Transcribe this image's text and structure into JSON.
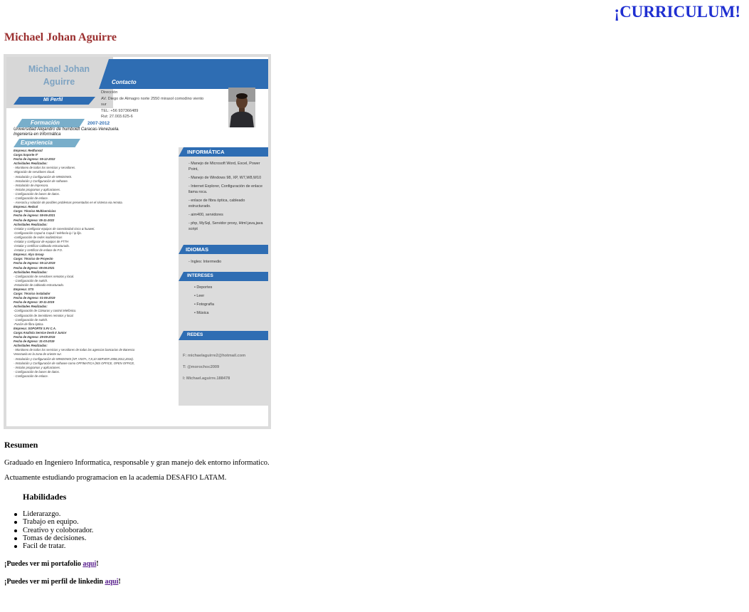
{
  "header": {
    "title": "¡CURRICULUM!"
  },
  "profile": {
    "name": "Michael Johan Aguirre"
  },
  "cv_image": {
    "name_line1": "Michael Johan",
    "name_line2": "Aguirre",
    "contact_label": "Contacto",
    "perfil_label": "Mi Perfil",
    "contact_lines": [
      "Dirección",
      "AV. Diego de Almagro norte 2550 mirasol comodino viento",
      "sur",
      "TEL: +56 937366489",
      "Rut: 27.003.625-6"
    ],
    "formacion_label": "Formación",
    "formacion_years": "2007-2012",
    "formacion_text": [
      "Universidad Alejandro de humboldt Caracas-Venezuela.",
      "Ingeniería en Informática"
    ],
    "experiencia_label": "Experiencia",
    "experiencia_lines": [
      "Empresa: Redfunsid",
      "Cargo:Soporte IT",
      "Fecha de ingreso: 05-12-2022",
      "Actividades Realizadas:",
      "- Monitoreo de todos los servicios y servidores.",
      "-Migración de servidores cloud.",
      "- Instalación y Configuración de WINDOWS.",
      "- Instalación y Configuración de software.",
      "- Instalación de impresora.",
      "- Instalar programas y aplicaciones.",
      "- Configuración de bases de datos.",
      "- Configuración de enlace.",
      "- Asesoría y solución de posibles problemas presentados en el sistema via remota.",
      "Empresa: Redsol",
      "Cargo: Técnico Multiservicios",
      "Fecha de ingreso: 08-06-2021",
      "Fecha de Egreso: 05-11-2022",
      "Actividades Realizadas:",
      "-instalar y configurar equipos de conectividad cisco & huawei.",
      "-Configuración Cayud & Cupuli / telefonía ip / ip fijo.",
      "-configuración de redes inalámbricas",
      "-instalar y configurar de equipos de FTTH",
      "-instalar y certificar cableado estructurado.",
      "-instalar y certificar de enlace de F.O.",
      "Empresa: Alyx Group",
      "Cargo: Técnico de Proyecto",
      "Fecha de Ingreso: 05-12-2019",
      "Fecha de Egreso: 05-06-2021",
      "Actividades Realizadas:",
      "- Configuración de servidores remotos y local.",
      "- Configuración de switch.",
      "-Instalación de cableado estructurado.",
      "Empresa: STS",
      "Cargo: Técnico instalador",
      "Fecha de Ingreso: 01-06-2019",
      "Fecha de Egreso: 30-11-2019",
      "Actividades Realizadas:",
      "-Configuración de Cámaras y control telefónico.",
      "-Configuración de Servidores remotos y local.",
      "- Configuración de switch.",
      "-Fusión de fibra óptica.",
      "Empresa: SOPORTE S.P.I C.A.",
      "Cargo:Analista Service Desk II Junior",
      "Fecha de Ingreso: 29-09-2015",
      "Fecha de Egreso: 31-03-2019",
      "Actividades Realizadas:",
      "- Monitoreo de todos los servicios y servidores de todas las agencias bancarias de Banesco",
      "Venezuela en la zona de oriente sur.",
      "- Instalación y Configuración de WINDOWS (XP, VISTA, 7,8,10 SERVER 2008,2012,2016).",
      "- Instalación y Configuración de software como OFFIMATICA (MS OFFICE, OPEN OFFICE,",
      "- Instalar programas y aplicaciones.",
      "- Configuración de bases de datos.",
      "- Configuración de enlace."
    ],
    "informatica_label": "INFORMÁTICA",
    "informatica_items": [
      "- Manejo de Microsoft Word, Excel, Power Point,",
      "- Manejo de Windows 98, XP, W7,W8,W10",
      "- Internet Explorer, Configuración de enlace llama roca.",
      "- enlace de fibra óptica, cableado estructurado.",
      "- aim400, servidores",
      "- php, MySql, Servidor proxy, Html java,java script"
    ],
    "idiomas_label": "IDIOMAS",
    "idiomas_items": [
      "- Ingles: Intermedio"
    ],
    "intereses_label": "INTERESES",
    "intereses_items": [
      "• Deportes",
      "• Leer",
      "• Fotografía",
      "• Música"
    ],
    "redes_label": "REDES",
    "redes_items": [
      "F: michaelaguirre2@hotmail.com",
      "T: @morochoc2009",
      "I: Michael.aguirre.188478"
    ]
  },
  "resumen": {
    "title": "Resumen",
    "p1": "Graduado en Ingeniero Informatica, responsable y gran manejo dek entorno informatico.",
    "p2": "Actuamente estudiando programacion en la academia DESAFIO LATAM."
  },
  "habilidades": {
    "title": "Habilidades",
    "items": [
      "Liderarazgo.",
      "Trabajo en equipo.",
      "Creativo y coloborador.",
      "Tomas de decisiones.",
      "Facil de tratar."
    ]
  },
  "links": {
    "portfolio_prefix": "¡Puedes ver mi portafolio ",
    "portfolio_link": "aqui",
    "portfolio_suffix": "!",
    "linkedin_prefix": "¡Puedes ver mi perfil de linkedin ",
    "linkedin_link": "aqui",
    "linkedin_suffix": "!"
  },
  "colors": {
    "title_blue": "#1f2fd1",
    "name_red": "#9b2f2f",
    "cv_blue": "#2e6db3",
    "cv_lightblue": "#79aeca",
    "link_purple": "#551a8b"
  }
}
